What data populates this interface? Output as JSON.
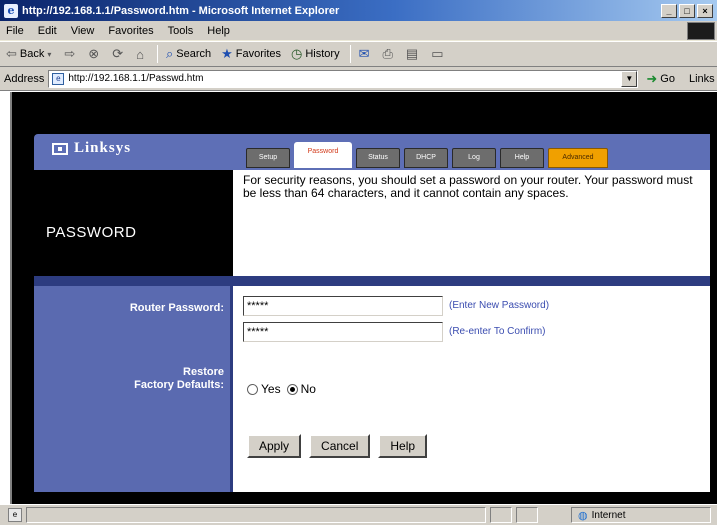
{
  "window": {
    "title": "http://192.168.1.1/Password.htm - Microsoft Internet Explorer",
    "controls": [
      "_",
      "□",
      "×"
    ]
  },
  "menubar": {
    "items": [
      "File",
      "Edit",
      "View",
      "Favorites",
      "Tools",
      "Help"
    ]
  },
  "toolbar": {
    "back": "Back",
    "search": "Search",
    "favorites": "Favorites",
    "history": "History"
  },
  "address": {
    "label": "Address",
    "url": "http://192.168.1.1/Passwd.htm",
    "go": "Go",
    "links": "Links"
  },
  "router": {
    "logo": "Linksys",
    "tabs": [
      "Setup",
      "Password",
      "Status",
      "DHCP",
      "Log",
      "Help",
      "Advanced"
    ],
    "active_tab": "Password",
    "section_title": "PASSWORD",
    "description": "For security reasons, you should set a password on your router. Your password must be less than 64 characters, and it cannot contain any spaces.",
    "form": {
      "password_label": "Router Password:",
      "password_value": "*****",
      "password_hint": "(Enter New Password)",
      "confirm_value": "*****",
      "confirm_hint": "(Re-enter To Confirm)",
      "restore_label_line1": "Restore",
      "restore_label_line2": "Factory Defaults:",
      "radio_yes": "Yes",
      "radio_no": "No",
      "selected": "No"
    },
    "buttons": {
      "apply": "Apply",
      "cancel": "Cancel",
      "help": "Help"
    }
  },
  "statusbar": {
    "zone": "Internet"
  }
}
